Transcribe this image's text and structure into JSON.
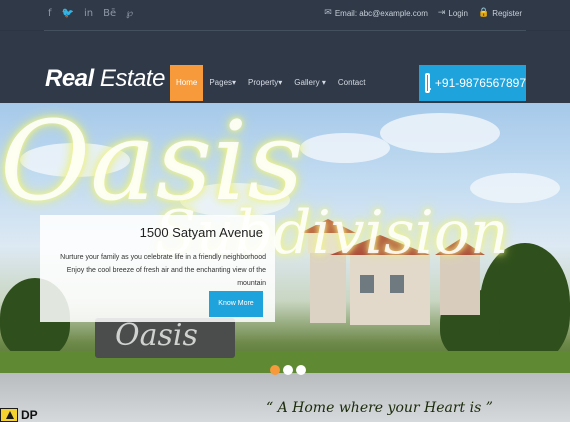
{
  "topbar": {
    "social": [
      {
        "name": "facebook-icon",
        "glyph": "f"
      },
      {
        "name": "twitter-icon",
        "glyph": "🐦"
      },
      {
        "name": "linkedin-icon",
        "glyph": "in"
      },
      {
        "name": "behance-icon",
        "glyph": "Bē"
      },
      {
        "name": "pinterest-icon",
        "glyph": "℘"
      }
    ],
    "email_label": "Email: abc@example.com",
    "login_label": "Login",
    "register_label": "Register"
  },
  "brand": {
    "bold": "Real",
    "light": " Estate"
  },
  "nav": {
    "home": "Home",
    "pages": "Pages",
    "property": "Property",
    "gallery": "Gallery",
    "contact": "Contact",
    "caret": "▾"
  },
  "phone": {
    "number": "+91-9876567897"
  },
  "hero": {
    "script_top": "Oasis",
    "script_bottom": "Subdivision",
    "caption_title": "1500 Satyam Avenue",
    "caption_text": "Nurture your family as you celebrate life in a friendly neighborhood Enjoy the cool breeze of fresh air and the enchanting view of the mountain",
    "more_button": "Know More",
    "wall_sign": "Oasis",
    "tagline": "“ A Home where your Heart is ”",
    "dp_logo": "DP",
    "slides": 3,
    "active_slide": 1
  },
  "colors": {
    "accent_orange": "#f79a3b",
    "accent_blue": "#1fa3dc",
    "header_bg": "#2f3948"
  }
}
